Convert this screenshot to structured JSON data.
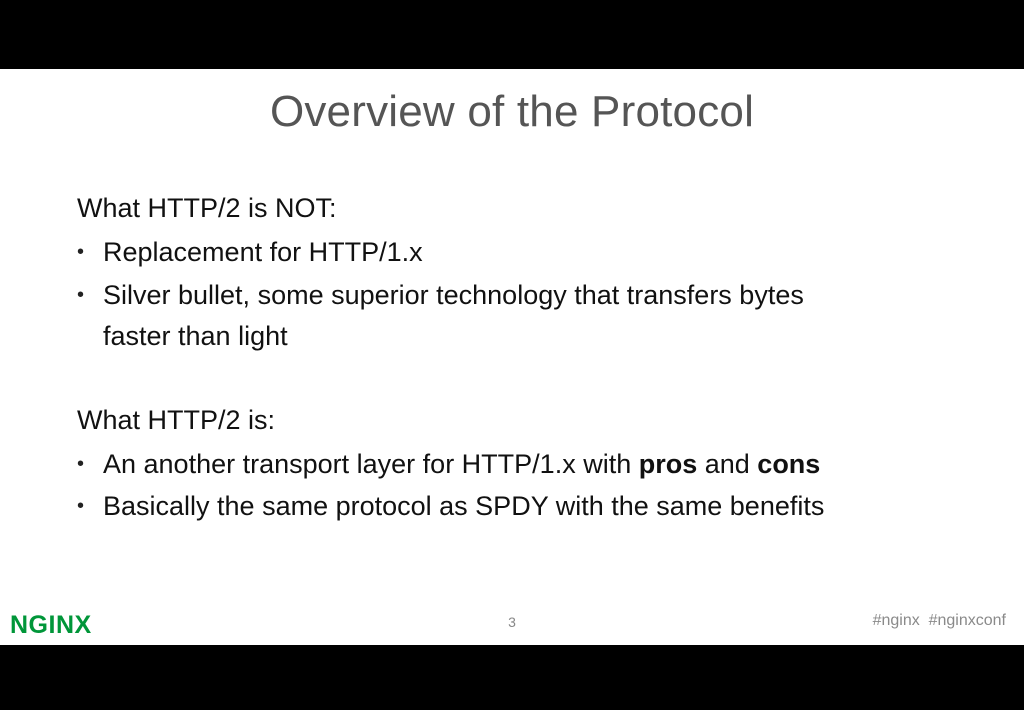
{
  "slide": {
    "title": "Overview of the Protocol",
    "section_not": {
      "heading": "What HTTP/2 is NOT:",
      "bullets": [
        "Replacement for HTTP/1.x",
        "Silver bullet, some superior technology that transfers bytes",
        "faster than light"
      ]
    },
    "section_is": {
      "heading": "What HTTP/2 is:",
      "bullet1": {
        "part1": "An another transport layer for HTTP/1.x with ",
        "bold1": "pros",
        "part2": " and ",
        "bold2": "cons"
      },
      "bullet2": "Basically the same protocol as SPDY with the same benefits"
    },
    "bullet_glyph": "•",
    "page_number": "3",
    "hashtags": "#nginx  #nginxconf",
    "logo_text": "NGINX",
    "brand_color": "#009639"
  }
}
